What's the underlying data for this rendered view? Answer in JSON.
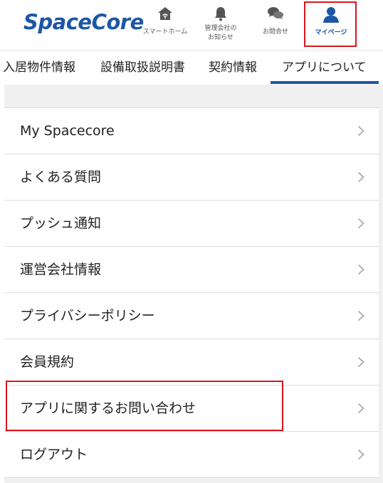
{
  "app": {
    "logo_text": "SpaceCore"
  },
  "nav": {
    "home": {
      "label": "スマートホーム",
      "icon": "smart-home-icon"
    },
    "notice": {
      "label_line1": "管理会社の",
      "label_line2": "お知らせ",
      "icon": "bell-icon"
    },
    "inquiry": {
      "label": "お問合せ",
      "icon": "chat-bubbles-icon"
    },
    "mypage": {
      "label": "マイページ",
      "icon": "user-icon",
      "active": true
    }
  },
  "tabs": [
    {
      "label": "入居物件情報"
    },
    {
      "label": "設備取扱説明書"
    },
    {
      "label": "契約情報"
    },
    {
      "label": "アプリについて",
      "active": true
    }
  ],
  "menu": {
    "items": [
      {
        "label": "My Spacecore"
      },
      {
        "label": "よくある質問"
      },
      {
        "label": "プッシュ通知"
      },
      {
        "label": "運営会社情報"
      },
      {
        "label": "プライバシーポリシー"
      },
      {
        "label": "会員規約"
      },
      {
        "label": "アプリに関するお問い合わせ"
      },
      {
        "label": "ログアウト"
      }
    ]
  },
  "colors": {
    "brand": "#1d56a7",
    "highlight": "#d9161d",
    "background": "#f0f0f0",
    "divider": "#dcdcdc"
  }
}
